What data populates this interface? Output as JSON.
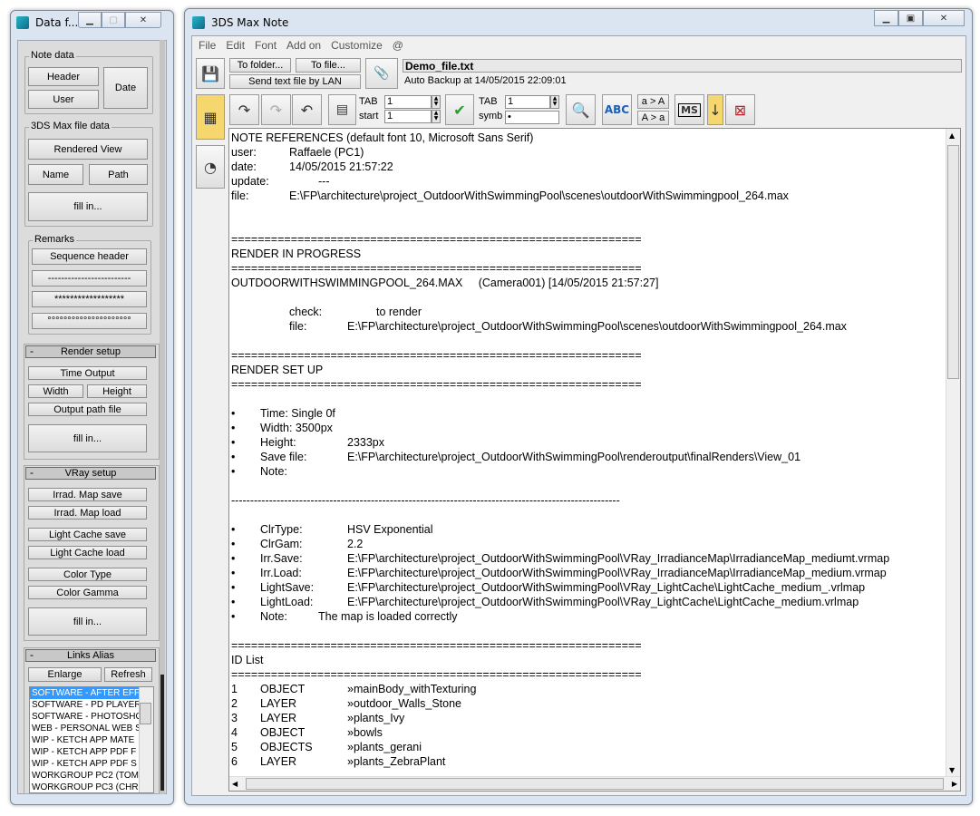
{
  "left_window": {
    "title": "Data f...",
    "note_data": {
      "label": "Note data",
      "header": "Header",
      "user": "User",
      "date": "Date"
    },
    "max_file_data": {
      "label": "3DS Max file data",
      "rendered_view": "Rendered View",
      "name": "Name",
      "path": "Path",
      "fill_in": "fill in..."
    },
    "remarks": {
      "label": "Remarks",
      "sequence_header": "Sequence header",
      "dash_line": "-------------------------",
      "star_line": "******************",
      "circle_line": "°°°°°°°°°°°°°°°°°°°°°"
    },
    "render_setup": {
      "label": "Render setup",
      "time_output": "Time Output",
      "width": "Width",
      "height": "Height",
      "output_path": "Output path file",
      "fill_in": "fill in..."
    },
    "vray_setup": {
      "label": "VRay setup",
      "irrad_save": "Irrad. Map save",
      "irrad_load": "Irrad. Map load",
      "lc_save": "Light Cache save",
      "lc_load": "Light Cache load",
      "color_type": "Color Type",
      "color_gamma": "Color Gamma",
      "fill_in": "fill in..."
    },
    "links_alias": {
      "label": "Links Alias",
      "enlarge": "Enlarge",
      "refresh": "Refresh",
      "items": [
        "SOFTWARE - AFTER EFF",
        "SOFTWARE - PD PLAYER",
        "SOFTWARE - PHOTOSHO",
        "WEB - PERSONAL WEB S",
        "WIP - KETCH APP MATE",
        "WIP - KETCH APP PDF F",
        "WIP - KETCH APP PDF S",
        "WORKGROUP PC2 (TOM",
        "WORKGROUP PC3 (CHR"
      ]
    }
  },
  "right_window": {
    "title": "3DS Max Note",
    "menu": [
      "File",
      "Edit",
      "Font",
      "Add on",
      "Customize",
      "@"
    ],
    "toolbar": {
      "to_folder": "To folder...",
      "to_file": "To file...",
      "send_lan": "Send text file by LAN",
      "filename": "Demo_file.txt",
      "autobackup": "Auto Backup at  14/05/2015 22:09:01",
      "tab_label": "TAB",
      "start_label": "start",
      "tab_value": "1",
      "start_value": "1",
      "tab2_label": "TAB",
      "symb_label": "symb",
      "tab2_value": "1",
      "symb_value": "•",
      "case_lower": "a > A",
      "case_upper": "A > a",
      "ms_label": "MS"
    },
    "document": {
      "lines": [
        "NOTE REFERENCES (default font 10, Microsoft Sans Serif)",
        "user:\t\tRaffaele (PC1)",
        "date:\t\t14/05/2015 21:57:22",
        "update:\t\t---",
        "file:\t\tE:\\FP\\architecture\\project_OutdoorWithSwimmingPool\\scenes\\outdoorWithSwimmingpool_264.max",
        "",
        "",
        "==============================================================",
        "RENDER IN PROGRESS",
        "==============================================================",
        "OUTDOORWITHSWIMMINGPOOL_264.MAX     (Camera001) [14/05/2015 21:57:27]",
        "",
        "\t\tcheck:\t\tto render",
        "\t\tfile:\t\tE:\\FP\\architecture\\project_OutdoorWithSwimmingPool\\scenes\\outdoorWithSwimmingpool_264.max",
        "",
        "==============================================================",
        "RENDER SET UP",
        "==============================================================",
        "",
        "•\tTime: Single 0f",
        "•\tWidth: 3500px",
        "•\tHeight:\t\t2333px",
        "•\tSave file:\t\tE:\\FP\\architecture\\project_OutdoorWithSwimmingPool\\renderoutput\\finalRenders\\View_01",
        "•\tNote:",
        "",
        "-------------------------------------------------------------------------------------------------------",
        "",
        "•\tClrType:\t\tHSV Exponential",
        "•\tClrGam:\t\t2.2",
        "•\tIrr.Save:\t\tE:\\FP\\architecture\\project_OutdoorWithSwimmingPool\\VRay_IrradianceMap\\IrradianceMap_mediumt.vrmap",
        "•\tIrr.Load:\t\tE:\\FP\\architecture\\project_OutdoorWithSwimmingPool\\VRay_IrradianceMap\\IrradianceMap_medium.vrmap",
        "•\tLightSave:\t\tE:\\FP\\architecture\\project_OutdoorWithSwimmingPool\\VRay_LightCache\\LightCache_medium_.vrlmap",
        "•\tLightLoad:\t\tE:\\FP\\architecture\\project_OutdoorWithSwimmingPool\\VRay_LightCache\\LightCache_medium.vrlmap",
        "•\tNote:\t\tThe map is loaded correctly",
        "",
        "==============================================================",
        "ID List",
        "==============================================================",
        "1\tOBJECT\t\t»mainBody_withTexturing",
        "2\tLAYER\t\t»outdoor_Walls_Stone",
        "3\tLAYER\t\t»plants_Ivy",
        "4\tOBJECT\t\t»bowls",
        "5\tOBJECTS\t\t»plants_gerani",
        "6\tLAYER\t\t»plants_ZebraPlant"
      ]
    }
  },
  "colors": {
    "accent_yellow": "#f5d76e",
    "selection": "#3399ff",
    "frame": "#dbe5f1"
  }
}
